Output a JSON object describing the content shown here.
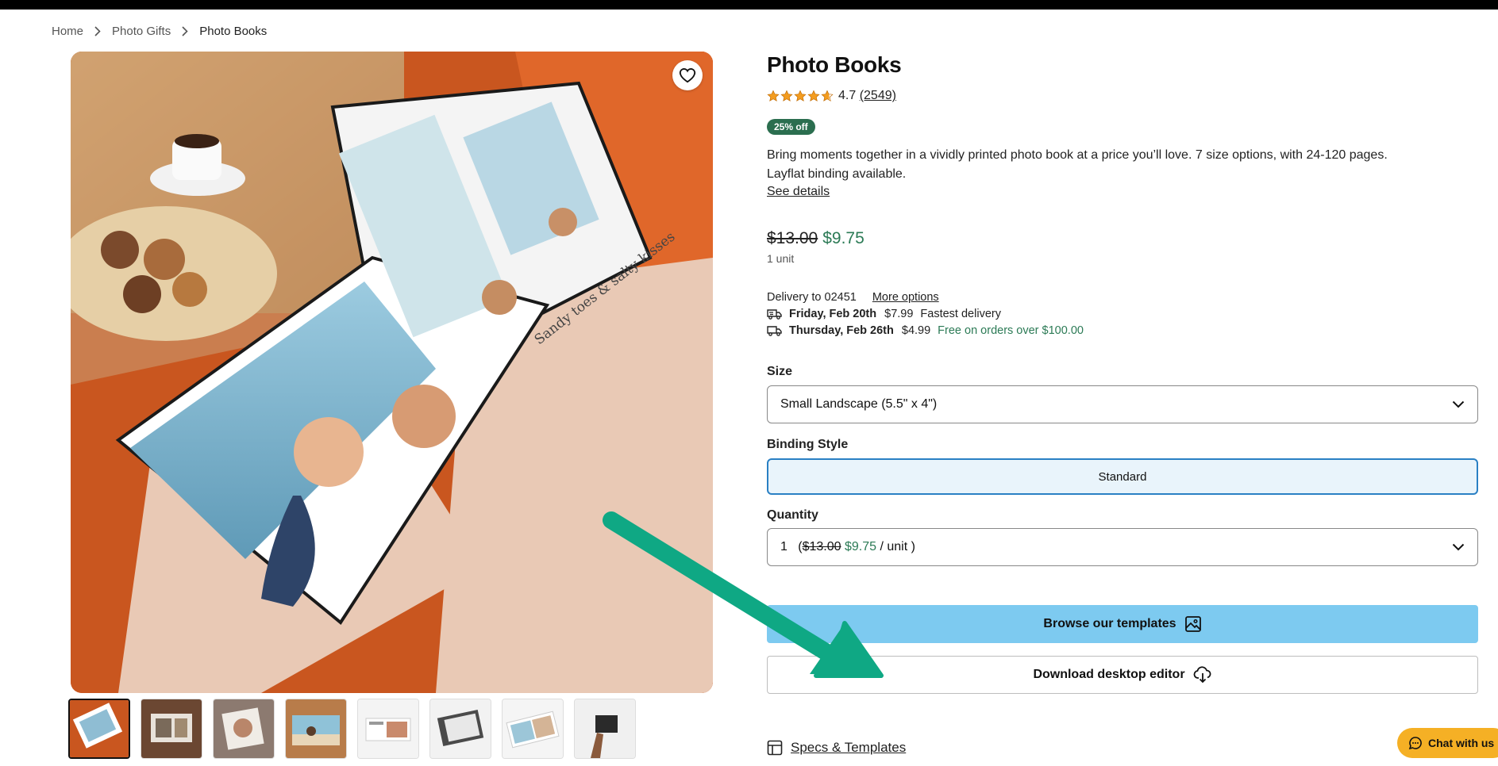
{
  "breadcrumb": {
    "items": [
      "Home",
      "Photo Gifts",
      "Photo Books"
    ]
  },
  "product": {
    "title": "Photo Books",
    "rating": "4.7",
    "rating_value": 4.7,
    "review_count": "(2549)",
    "discount_badge": "25% off",
    "description": "Bring moments together in a vividly printed photo book at a price you’ll love. 7 size options, with 24-120 pages. Layflat binding available.",
    "see_details": "See details",
    "hero_image_text": "Sandy toes & salty kisses"
  },
  "price": {
    "original": "$13.00",
    "sale": "$9.75",
    "unit": "1 unit"
  },
  "delivery": {
    "to": "Delivery to 02451",
    "more_options": "More options",
    "options": [
      {
        "day": "Friday, Feb 20th",
        "cost": "$7.99",
        "note": "Fastest delivery",
        "note_color": "#222222"
      },
      {
        "day": "Thursday, Feb 26th",
        "cost": "$4.99",
        "note": "Free on orders over $100.00",
        "note_color": "#2b7a55"
      }
    ]
  },
  "size": {
    "label": "Size",
    "value": "Small Landscape (5.5\" x 4\")"
  },
  "binding": {
    "label": "Binding Style",
    "value": "Standard"
  },
  "quantity": {
    "label": "Quantity",
    "value": "1",
    "open_paren": "(",
    "old_price": "$13.00",
    "new_price": "$9.75",
    "suffix": "/ unit )"
  },
  "actions": {
    "browse_templates": "Browse our templates",
    "download_editor": "Download desktop editor"
  },
  "specs": {
    "label": "Specs & Templates"
  },
  "chat": {
    "label": "Chat with us"
  },
  "colors": {
    "accent_green": "#2b7a55",
    "badge_green": "#2b6e4f",
    "primary_button": "#7dcaf0",
    "binding_border": "#2a80c4",
    "chat_button": "#f5b025",
    "annotation_arrow": "#0fa884"
  },
  "annotation": {
    "type": "arrow",
    "points_to": "download-editor-button"
  }
}
